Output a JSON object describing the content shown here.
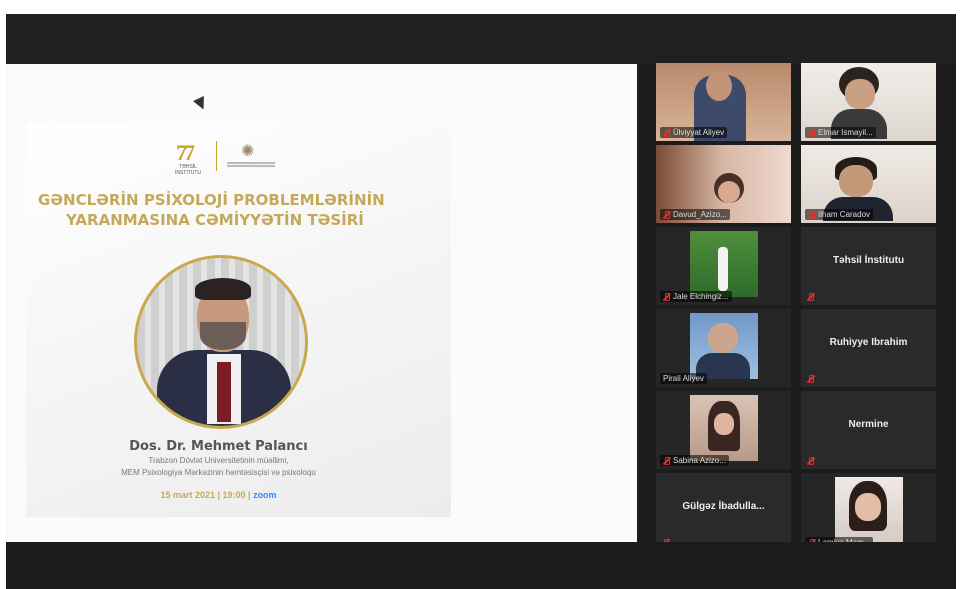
{
  "presentation": {
    "logo_caption": "TƏHSİL İNSTİTUTU",
    "title_line1": "GƏNCLƏRİN PSİXOLOJİ PROBLEMLƏRİNİN",
    "title_line2": "YARANMASINA CƏMİYYƏTİN TƏSİRİ",
    "speaker_name": "Dos. Dr. Mehmet Palancı",
    "speaker_role_line1": "Trabzon Dövlət Universitetinin müəllimi,",
    "speaker_role_line2": "MEM Psixologiya Mərkəzinin həmtəsisçisi və psixoloqu",
    "date_time": "15 mart 2021 | 19:00 |",
    "platform": "zoom"
  },
  "gallery": {
    "participants": [
      {
        "name": "Ülviyyat Aliyev",
        "video": true,
        "muted": true
      },
      {
        "name": "Elmar Ismayil...",
        "video": true,
        "muted": true
      },
      {
        "name": "Davud_Azizo...",
        "video": true,
        "muted": true
      },
      {
        "name": "Ilham Caradov",
        "video": true,
        "muted": true,
        "active": true
      },
      {
        "name": "Jale Elchingiz...",
        "video": true,
        "muted": true
      },
      {
        "name": "Təhsil İnstitutu",
        "video": false,
        "muted": true
      },
      {
        "name": "Pirali Aliyev",
        "video": true,
        "muted": false
      },
      {
        "name": "Ruhiyye Ibrahim",
        "video": false,
        "muted": true
      },
      {
        "name": "Sabina Azizo...",
        "video": true,
        "muted": true
      },
      {
        "name": "Nermine",
        "video": false,
        "muted": true
      },
      {
        "name": "Gülgəz İbadulla...",
        "video": false,
        "muted": true
      },
      {
        "name": "Lamiyə Mam...",
        "video": true,
        "muted": true
      }
    ]
  },
  "colors": {
    "accent_gold": "#c5a95a",
    "zoom_blue": "#2d8cff",
    "muted_red": "#e23030",
    "active_speaker": "#9bd16a"
  }
}
